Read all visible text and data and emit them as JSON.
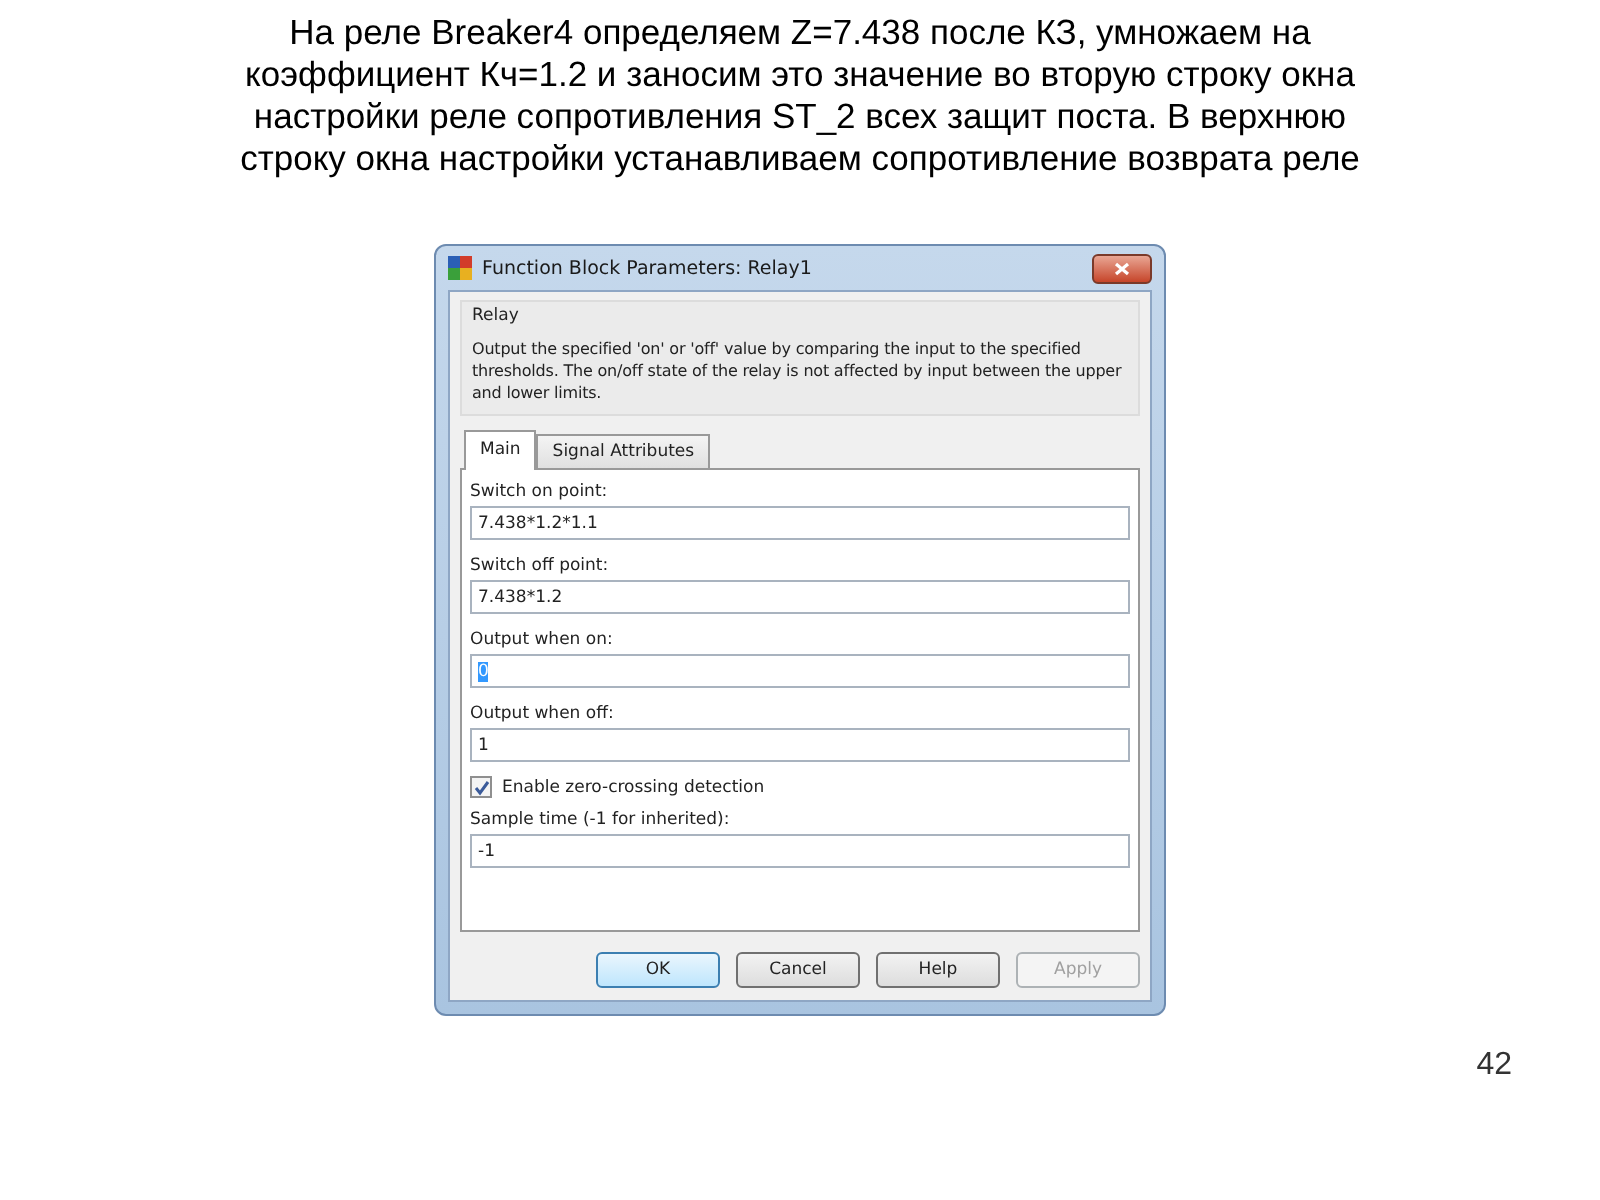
{
  "slide": {
    "heading": "На реле Breaker4 определяем Z=7.438 после КЗ, умножаем на\nкоэффициент Кч=1.2 и  заносим это значение во вторую строку окна\nнастройки реле сопротивления ST_2 всех защит поста. В верхнюю\nстроку окна настройки устанавливаем сопротивление возврата реле",
    "page_number": "42"
  },
  "window": {
    "title": "Function Block Parameters: Relay1"
  },
  "group": {
    "title": "Relay",
    "description": "Output the specified 'on' or 'off' value by comparing the input to the specified thresholds.  The on/off state of the relay is not affected by input between the upper and lower limits."
  },
  "tabs": [
    {
      "label": "Main",
      "selected": true
    },
    {
      "label": "Signal Attributes",
      "selected": false
    }
  ],
  "parameters": [
    {
      "kind": "field",
      "label": "Switch on point:",
      "value": "7.438*1.2*1.1",
      "highlighted": false
    },
    {
      "kind": "field",
      "label": "Switch off point:",
      "value": "7.438*1.2",
      "highlighted": false
    },
    {
      "kind": "field",
      "label": "Output when on:",
      "value": "0",
      "highlighted": true
    },
    {
      "kind": "field",
      "label": "Output when off:",
      "value": "1",
      "highlighted": false
    },
    {
      "kind": "checkbox",
      "label": "Enable zero-crossing detection",
      "checked": true
    },
    {
      "kind": "field",
      "label": "Sample time (-1 for inherited):",
      "value": "-1",
      "highlighted": false
    }
  ],
  "buttons": [
    {
      "label": "OK",
      "default": true,
      "disabled": false
    },
    {
      "label": "Cancel",
      "default": false,
      "disabled": false
    },
    {
      "label": "Help",
      "default": false,
      "disabled": false
    },
    {
      "label": "Apply",
      "default": false,
      "disabled": true
    }
  ]
}
